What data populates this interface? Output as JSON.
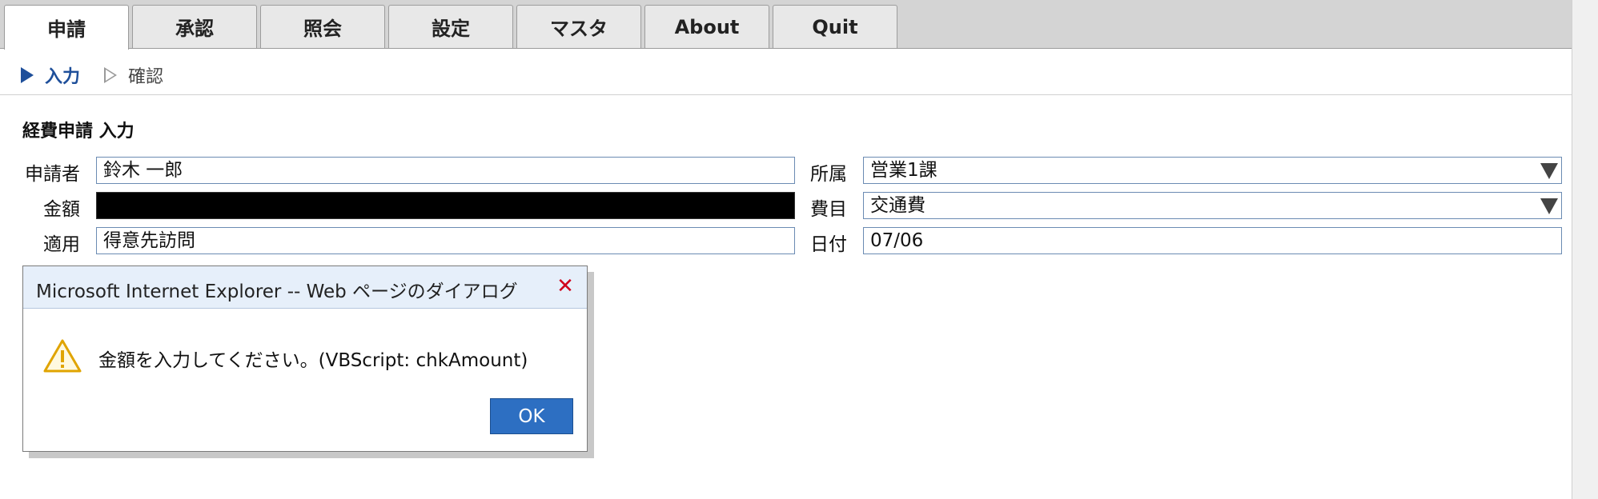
{
  "tabs": [
    {
      "label": "申請",
      "active": true
    },
    {
      "label": "承認",
      "active": false
    },
    {
      "label": "照会",
      "active": false
    },
    {
      "label": "設定",
      "active": false
    },
    {
      "label": "マスタ",
      "active": false
    },
    {
      "label": "About",
      "active": false
    },
    {
      "label": "Quit",
      "active": false
    }
  ],
  "breadcrumb": {
    "step1": "入力",
    "step2": "確認"
  },
  "form": {
    "title": "経費申請 入力",
    "applicant_label": "申請者",
    "applicant_value": "鈴木 一郎",
    "amount_label": "金額",
    "amount_value": "",
    "note_label": "適用",
    "note_value": "得意先訪問",
    "department_label": "所属",
    "department_value": "営業1課",
    "category_label": "費目",
    "category_value": "交通費",
    "date_label": "日付",
    "date_value": "07/06"
  },
  "dialog": {
    "title": "Microsoft Internet Explorer -- Web ページのダイアログ",
    "message": "金額を入力してください。(VBScript: chkAmount)",
    "ok_label": "OK"
  },
  "colors": {
    "accent": "#1e4f9a",
    "ok_button": "#2d6fc2",
    "close_x": "#d0021b",
    "warning": "#e0a400"
  },
  "icons": {
    "close": "close-icon",
    "warning": "warning-icon",
    "dropdown": "chevron-down-icon"
  }
}
